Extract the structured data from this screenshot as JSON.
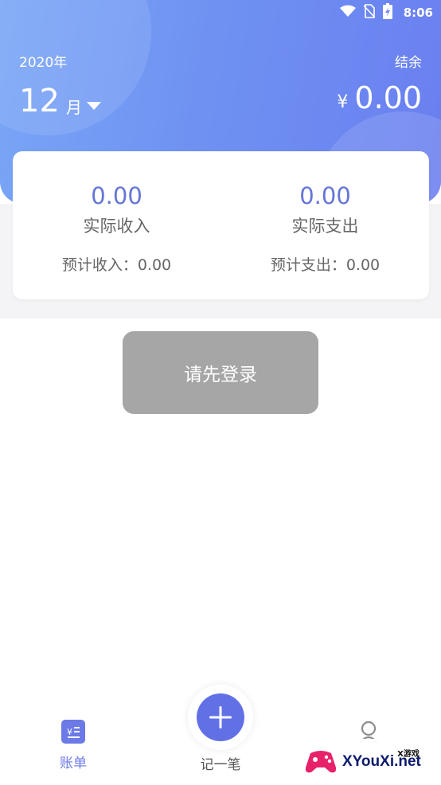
{
  "status_bar": {
    "time": "8:06",
    "icons": [
      "wifi-icon",
      "no-sim-icon",
      "battery-charging-icon"
    ]
  },
  "header": {
    "year": "2020年",
    "month": "12",
    "month_unit": "月",
    "balance_label": "结余",
    "currency_symbol": "¥",
    "balance_value": "0.00"
  },
  "summary": {
    "income_amount": "0.00",
    "income_label": "实际收入",
    "income_estimate": "预计收入：0.00",
    "expense_amount": "0.00",
    "expense_label": "实际支出",
    "expense_estimate": "预计支出：0.00"
  },
  "login_prompt": "请先登录",
  "bottom_nav": {
    "bill_label": "账单",
    "add_label": "记一笔",
    "accent": "#6b7ae6"
  },
  "watermark": {
    "main": "XYouXi.net",
    "small": "X游戏"
  },
  "colors": {
    "header_gradient_start": "#79a6f6",
    "header_gradient_end": "#6a7ff0",
    "amount": "#6576d6",
    "login_button": "#a6a6a6"
  }
}
